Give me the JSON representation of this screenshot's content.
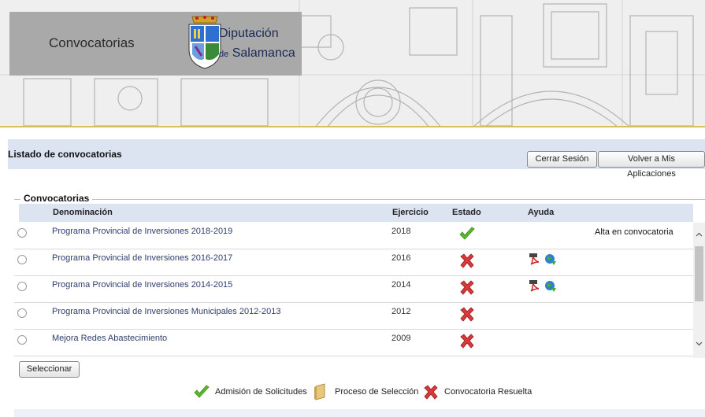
{
  "header": {
    "app_title": "Convocatorias",
    "org_line1": "Diputación",
    "org_line2_prefix": "de",
    "org_line2_name": "Salamanca"
  },
  "titlebar": {
    "page_title": "Listado de convocatorias",
    "logout_label": "Cerrar Sesión",
    "back_label": "Volver a Mis Aplicaciones"
  },
  "list": {
    "legend": "Convocatorias",
    "columns": [
      "Denominación",
      "Ejercicio",
      "Estado",
      "Ayuda"
    ],
    "rows": [
      {
        "name": "Programa Provincial de Inversiones 2018-2019",
        "year": "2018",
        "state": "check-icon",
        "pdf": false,
        "web": false,
        "note": "Alta en convocatoria"
      },
      {
        "name": "Programa Provincial de Inversiones 2016-2017",
        "year": "2016",
        "state": "cross-icon",
        "pdf": true,
        "web": true,
        "note": ""
      },
      {
        "name": "Programa Provincial de Inversiones 2014-2015",
        "year": "2014",
        "state": "cross-icon",
        "pdf": true,
        "web": true,
        "note": ""
      },
      {
        "name": "Programa Provincial de Inversiones Municipales 2012-2013",
        "year": "2012",
        "state": "cross-icon",
        "pdf": false,
        "web": false,
        "note": ""
      },
      {
        "name": "Mejora Redes Abastecimiento",
        "year": "2009",
        "state": "cross-icon",
        "pdf": false,
        "web": false,
        "note": ""
      }
    ],
    "select_label": "Seleccionar"
  },
  "legend_bar": {
    "admision": "Admisión de Solicitudes",
    "seleccion": "Proceso de Selección",
    "resuelta": "Convocatoria Resuelta"
  },
  "colors": {
    "header_band": "#dce4f2",
    "link": "#2e3e6e",
    "gold": "#d6c057",
    "check": "#5cb82a",
    "cross": "#d63a3a"
  }
}
